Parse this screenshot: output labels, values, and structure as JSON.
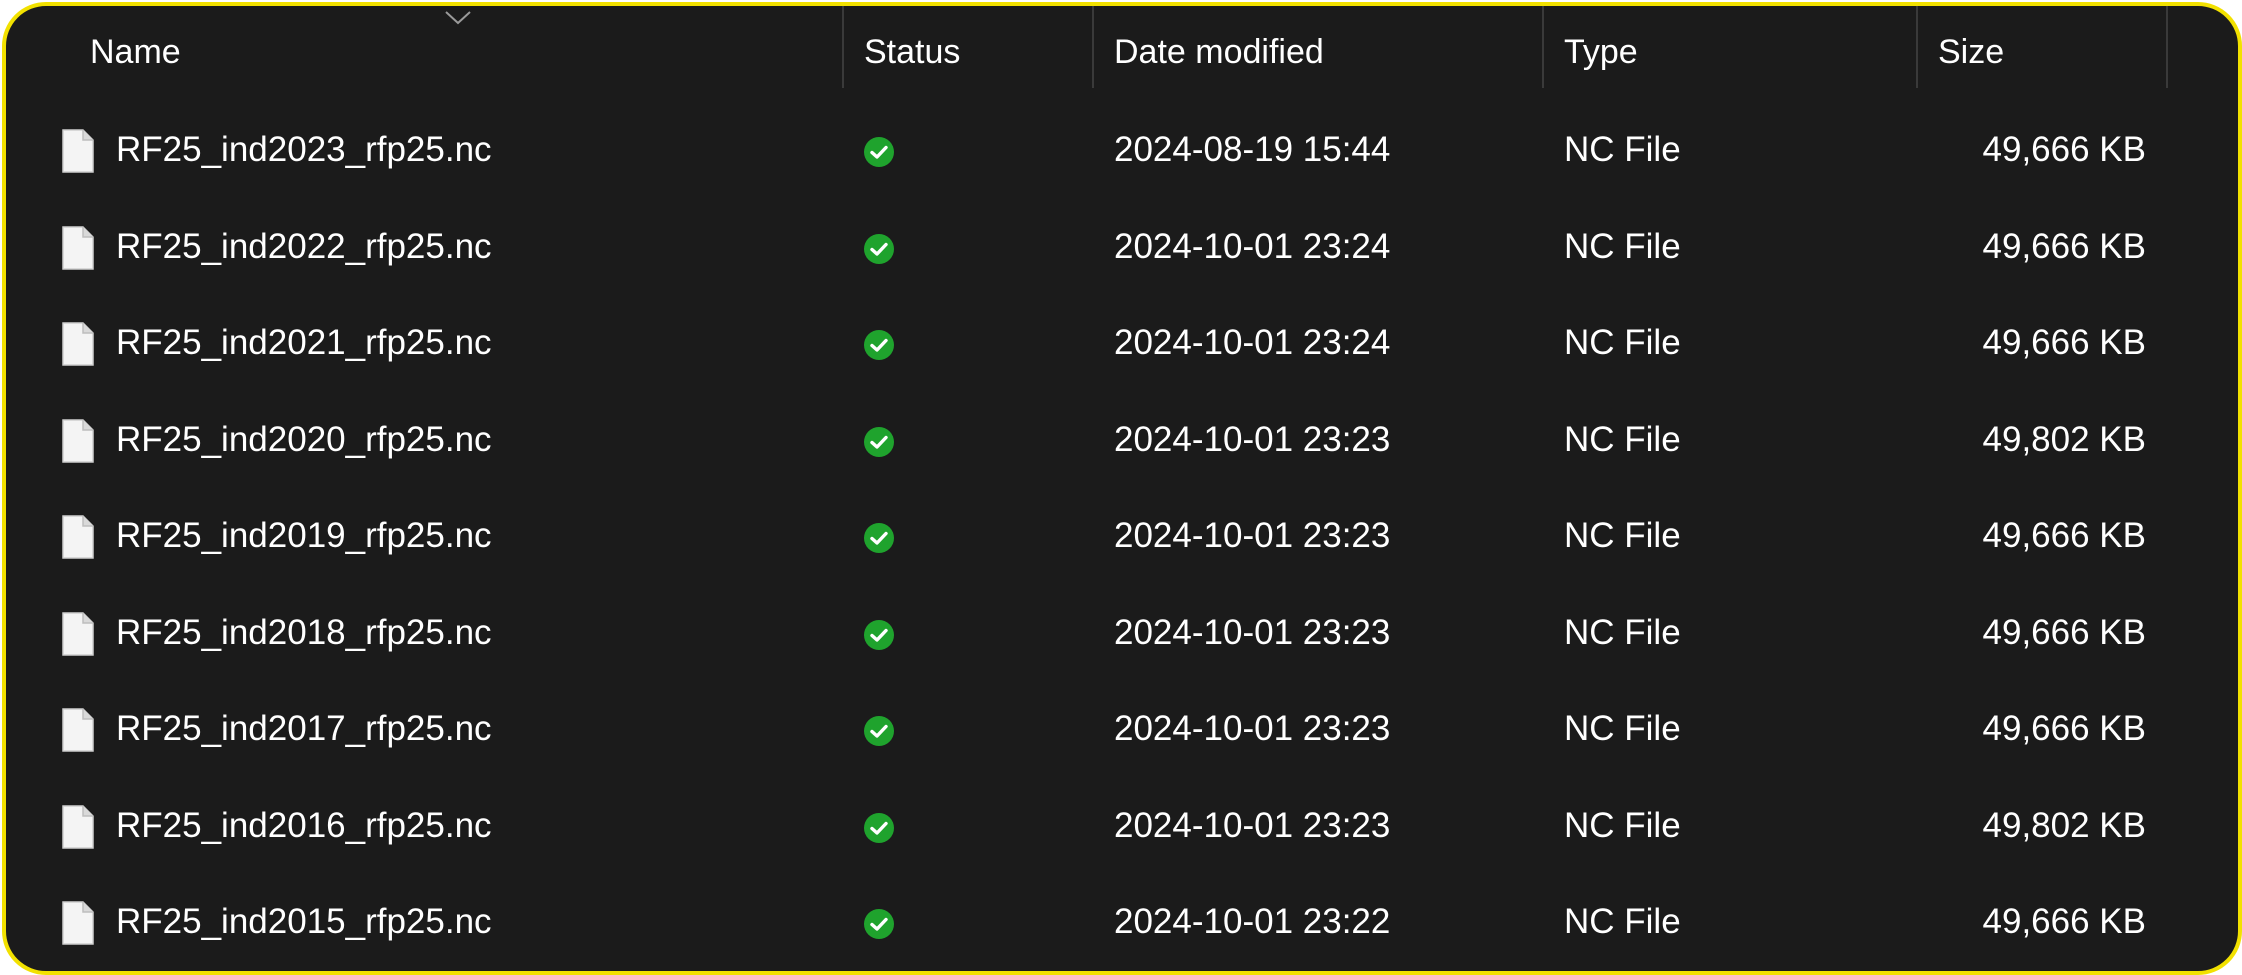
{
  "columns": {
    "name": "Name",
    "status": "Status",
    "date_modified": "Date modified",
    "type": "Type",
    "size": "Size"
  },
  "icons": {
    "file": "file-icon",
    "status": "synced-check-icon",
    "sort": "chevron-down-icon"
  },
  "colors": {
    "background": "#1b1b1b",
    "border": "#f2e100",
    "status_green": "#1fa32d",
    "text": "#ffffff"
  },
  "files": [
    {
      "name": "RF25_ind2023_rfp25.nc",
      "date": "2024-08-19 15:44",
      "type": "NC File",
      "size": "49,666 KB"
    },
    {
      "name": "RF25_ind2022_rfp25.nc",
      "date": "2024-10-01 23:24",
      "type": "NC File",
      "size": "49,666 KB"
    },
    {
      "name": "RF25_ind2021_rfp25.nc",
      "date": "2024-10-01 23:24",
      "type": "NC File",
      "size": "49,666 KB"
    },
    {
      "name": "RF25_ind2020_rfp25.nc",
      "date": "2024-10-01 23:23",
      "type": "NC File",
      "size": "49,802 KB"
    },
    {
      "name": "RF25_ind2019_rfp25.nc",
      "date": "2024-10-01 23:23",
      "type": "NC File",
      "size": "49,666 KB"
    },
    {
      "name": "RF25_ind2018_rfp25.nc",
      "date": "2024-10-01 23:23",
      "type": "NC File",
      "size": "49,666 KB"
    },
    {
      "name": "RF25_ind2017_rfp25.nc",
      "date": "2024-10-01 23:23",
      "type": "NC File",
      "size": "49,666 KB"
    },
    {
      "name": "RF25_ind2016_rfp25.nc",
      "date": "2024-10-01 23:23",
      "type": "NC File",
      "size": "49,802 KB"
    },
    {
      "name": "RF25_ind2015_rfp25.nc",
      "date": "2024-10-01 23:22",
      "type": "NC File",
      "size": "49,666 KB"
    }
  ]
}
